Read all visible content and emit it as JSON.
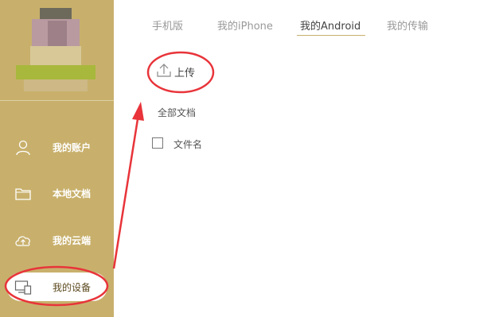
{
  "sidebar": {
    "items": [
      {
        "label": "我的账户",
        "icon": "user-icon"
      },
      {
        "label": "本地文档",
        "icon": "folder-icon"
      },
      {
        "label": "我的云端",
        "icon": "cloud-upload-icon"
      },
      {
        "label": "我的设备",
        "icon": "devices-icon",
        "active": true
      }
    ]
  },
  "tabs": [
    {
      "label": "手机版"
    },
    {
      "label": "我的iPhone"
    },
    {
      "label": "我的Android",
      "active": true
    },
    {
      "label": "我的传输"
    }
  ],
  "toolbar": {
    "upload_label": "上传"
  },
  "main": {
    "all_docs_label": "全部文档",
    "column_filename": "文件名"
  },
  "colors": {
    "sidebar_bg": "#c8b06c",
    "annotation_red": "#e8343a",
    "active_tab_underline": "#c8b06c"
  }
}
